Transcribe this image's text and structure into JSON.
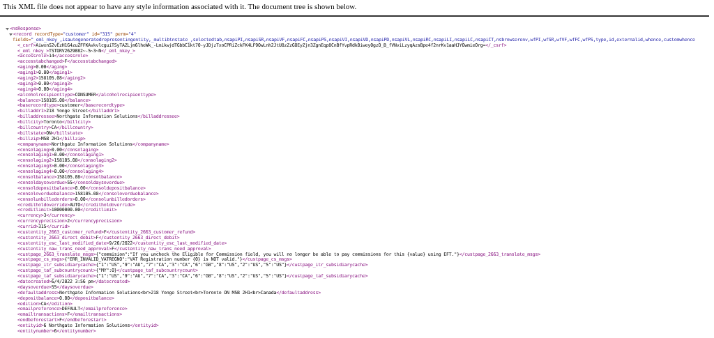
{
  "notice": "This XML file does not appear to have any style information associated with it. The document tree is shown below.",
  "tree": {
    "open": "<nsResponse>",
    "expanded": true,
    "children": [
      {
        "open_start": "<record",
        "expanded": true,
        "attributes": [
          {
            "name": "recordType=",
            "value": "\"customer\""
          },
          {
            "name": "id=",
            "value": "\"315\""
          },
          {
            "name": "perm=",
            "value": "\"4\""
          }
        ],
        "wrapped_attributes": [
          {
            "name": "fields=",
            "value": "\"_eml_nkey_,isautogeneratedrepresentingentity,_multibtnstate_,selectedtab,nsapiPI,nsapiSR,nsapiVF,nsapiFC,nsapiPS,nsapiVI,nsapiVD,nsapiPD,nsapiVL,nsapiRC,nsapiLI,nsapiLC,nsapiCT,nsbrowserenv,wfPI,wfSR,wfVF,wfFC,wfPS,type,id,externalid,whence,customwhence"
          }
        ],
        "children": [
          {
            "open": "<_csrf>",
            "text": "AiwxnS2vEzH1G4zuZFFKAvkvlcguiTSyTAZLjm6lheWk_-LmikwjdTGbbC1kt70-yJDjzTxoCPRiZckFK4LF9OwLnh2JtU8zZzGOEyZjn3ZgnEqp8CnBfYvpRdk0iwey0gzO_B_fVNviLzyqAzsBpe4f2nrKv1aaHJYOwmieOrg=",
            "close": "</_csrf>"
          },
          {
            "open": "<_eml_nkey_>",
            "text": "TSTDRV2629082~-5~3~N",
            "close": "</_eml_nkey_>"
          },
          {
            "open": "<accessrole>",
            "text": "14",
            "close": "</accessrole>"
          },
          {
            "open": "<accesstabchanged>",
            "text": "F",
            "close": "</accesstabchanged>"
          },
          {
            "open": "<aging>",
            "text": "0.00",
            "close": "</aging>"
          },
          {
            "open": "<aging1>",
            "text": "0.00",
            "close": "</aging1>"
          },
          {
            "open": "<aging2>",
            "text": "158105.08",
            "close": "</aging2>"
          },
          {
            "open": "<aging3>",
            "text": "0.00",
            "close": "</aging3>"
          },
          {
            "open": "<aging4>",
            "text": "0.00",
            "close": "</aging4>"
          },
          {
            "open": "<alcoholrecipienttype>",
            "text": "CONSUMER",
            "close": "</alcoholrecipienttype>"
          },
          {
            "open": "<balance>",
            "text": "158105.08",
            "close": "</balance>"
          },
          {
            "open": "<baserecordtype>",
            "text": "customer",
            "close": "</baserecordtype>"
          },
          {
            "open": "<billaddr1>",
            "text": "218 Yonge Street",
            "close": "</billaddr1>"
          },
          {
            "open": "<billaddressee>",
            "text": "Northgate Information Solutions",
            "close": "</billaddressee>"
          },
          {
            "open": "<billcity>",
            "text": "Toronto",
            "close": "</billcity>"
          },
          {
            "open": "<billcountry>",
            "text": "CA",
            "close": "</billcountry>"
          },
          {
            "open": "<billstate>",
            "text": "ON",
            "close": "</billstate>"
          },
          {
            "open": "<billzip>",
            "text": "M5B 2H1",
            "close": "</billzip>"
          },
          {
            "open": "<companyname>",
            "text": "Northgate Information Solutions",
            "close": "</companyname>"
          },
          {
            "open": "<consolaging>",
            "text": "0.00",
            "close": "</consolaging>"
          },
          {
            "open": "<consolaging1>",
            "text": "0.00",
            "close": "</consolaging1>"
          },
          {
            "open": "<consolaging2>",
            "text": "158105.08",
            "close": "</consolaging2>"
          },
          {
            "open": "<consolaging3>",
            "text": "0.00",
            "close": "</consolaging3>"
          },
          {
            "open": "<consolaging4>",
            "text": "0.00",
            "close": "</consolaging4>"
          },
          {
            "open": "<consolbalance>",
            "text": "158105.08",
            "close": "</consolbalance>"
          },
          {
            "open": "<consoldaysoverdue>",
            "text": "55",
            "close": "</consoldaysoverdue>"
          },
          {
            "open": "<consoldepositbalance>",
            "text": "0.00",
            "close": "</consoldepositbalance>"
          },
          {
            "open": "<consoloverduebalance>",
            "text": "158105.08",
            "close": "</consoloverduebalance>"
          },
          {
            "open": "<consolunbilledorders>",
            "text": "0.00",
            "close": "</consolunbilledorders>"
          },
          {
            "open": "<creditholdoverride>",
            "text": "AUTO",
            "close": "</creditholdoverride>"
          },
          {
            "open": "<creditlimit>",
            "text": "10000000.00",
            "close": "</creditlimit>"
          },
          {
            "open": "<currency>",
            "text": "3",
            "close": "</currency>"
          },
          {
            "open": "<currencyprecision>",
            "text": "2",
            "close": "</currencyprecision>"
          },
          {
            "open": "<currid>",
            "text": "315",
            "close": "</currid>"
          },
          {
            "open": "<custentity_2663_customer_refund>",
            "text": "F",
            "close": "</custentity_2663_customer_refund>"
          },
          {
            "open": "<custentity_2663_direct_debit>",
            "text": "F",
            "close": "</custentity_2663_direct_debit>"
          },
          {
            "open": "<custentity_esc_last_modified_date>",
            "text": "9/26/2022",
            "close": "</custentity_esc_last_modified_date>"
          },
          {
            "open": "<custentity_naw_trans_need_approval>",
            "text": "F",
            "close": "</custentity_naw_trans_need_approval>"
          },
          {
            "open": "<custpage_2663_translate_msgs>",
            "text": "{\"commision\":\"If you uncheck the Eligible for Commission field, you will no longer be able to pay commissions for this {value} using EFT.\"}",
            "close": "</custpage_2663_translate_msgs>"
          },
          {
            "open": "<custpage_cs_msgs>",
            "text": "{\"ERR_INVALID_VATREGNO\":\"VAT Registration number {0} is NOT valid.\"}",
            "close": "</custpage_cs_msgs>"
          },
          {
            "open": "<custpage_itr_subsidiarycache>",
            "text": "{\"1\":\"US\",\"9\":\"AU\",\"7\":\"CA\",\"3\":\"CA\",\"6\":\"GB\",\"8\":\"US\",\"2\":\"US\",\"5\":\"US\"}",
            "close": "</custpage_itr_subsidiarycache>"
          },
          {
            "open": "<custpage_taf_subcountrycount>",
            "text": "{\"MY\":0}",
            "close": "</custpage_taf_subcountrycount>"
          },
          {
            "open": "<custpage_taf_subsidiarycache>",
            "text": "{\"1\":\"US\",\"9\":\"AU\",\"7\":\"CA\",\"3\":\"CA\",\"6\":\"GB\",\"8\":\"US\",\"2\":\"US\",\"5\":\"US\"}",
            "close": "</custpage_taf_subsidiarycache>"
          },
          {
            "open": "<datecreated>",
            "text": "6/4/2022 3:56 pm",
            "close": "</datecreated>"
          },
          {
            "open": "<daysoverdue>",
            "text": "55",
            "close": "</daysoverdue>"
          },
          {
            "open": "<defaultaddress>",
            "text": "Northgate Information Solutions<br>218 Yonge Street<br>Toronto ON M5B 2H1<br>Canada",
            "close": "</defaultaddress>"
          },
          {
            "open": "<depositbalance>",
            "text": "0.00",
            "close": "</depositbalance>"
          },
          {
            "open": "<edition>",
            "text": "CA",
            "close": "</edition>"
          },
          {
            "open": "<emailpreference>",
            "text": "DEFAULT",
            "close": "</emailpreference>"
          },
          {
            "open": "<emailtransactions>",
            "text": "F",
            "close": "</emailtransactions>"
          },
          {
            "open": "<endbeforestart>",
            "text": "F",
            "close": "</endbeforestart>"
          },
          {
            "open": "<entityid>",
            "text": "6 Northgate Information Solutions",
            "close": "</entityid>"
          },
          {
            "open": "<entitynumber>",
            "text": "6",
            "close": "</entitynumber>"
          }
        ]
      }
    ]
  }
}
